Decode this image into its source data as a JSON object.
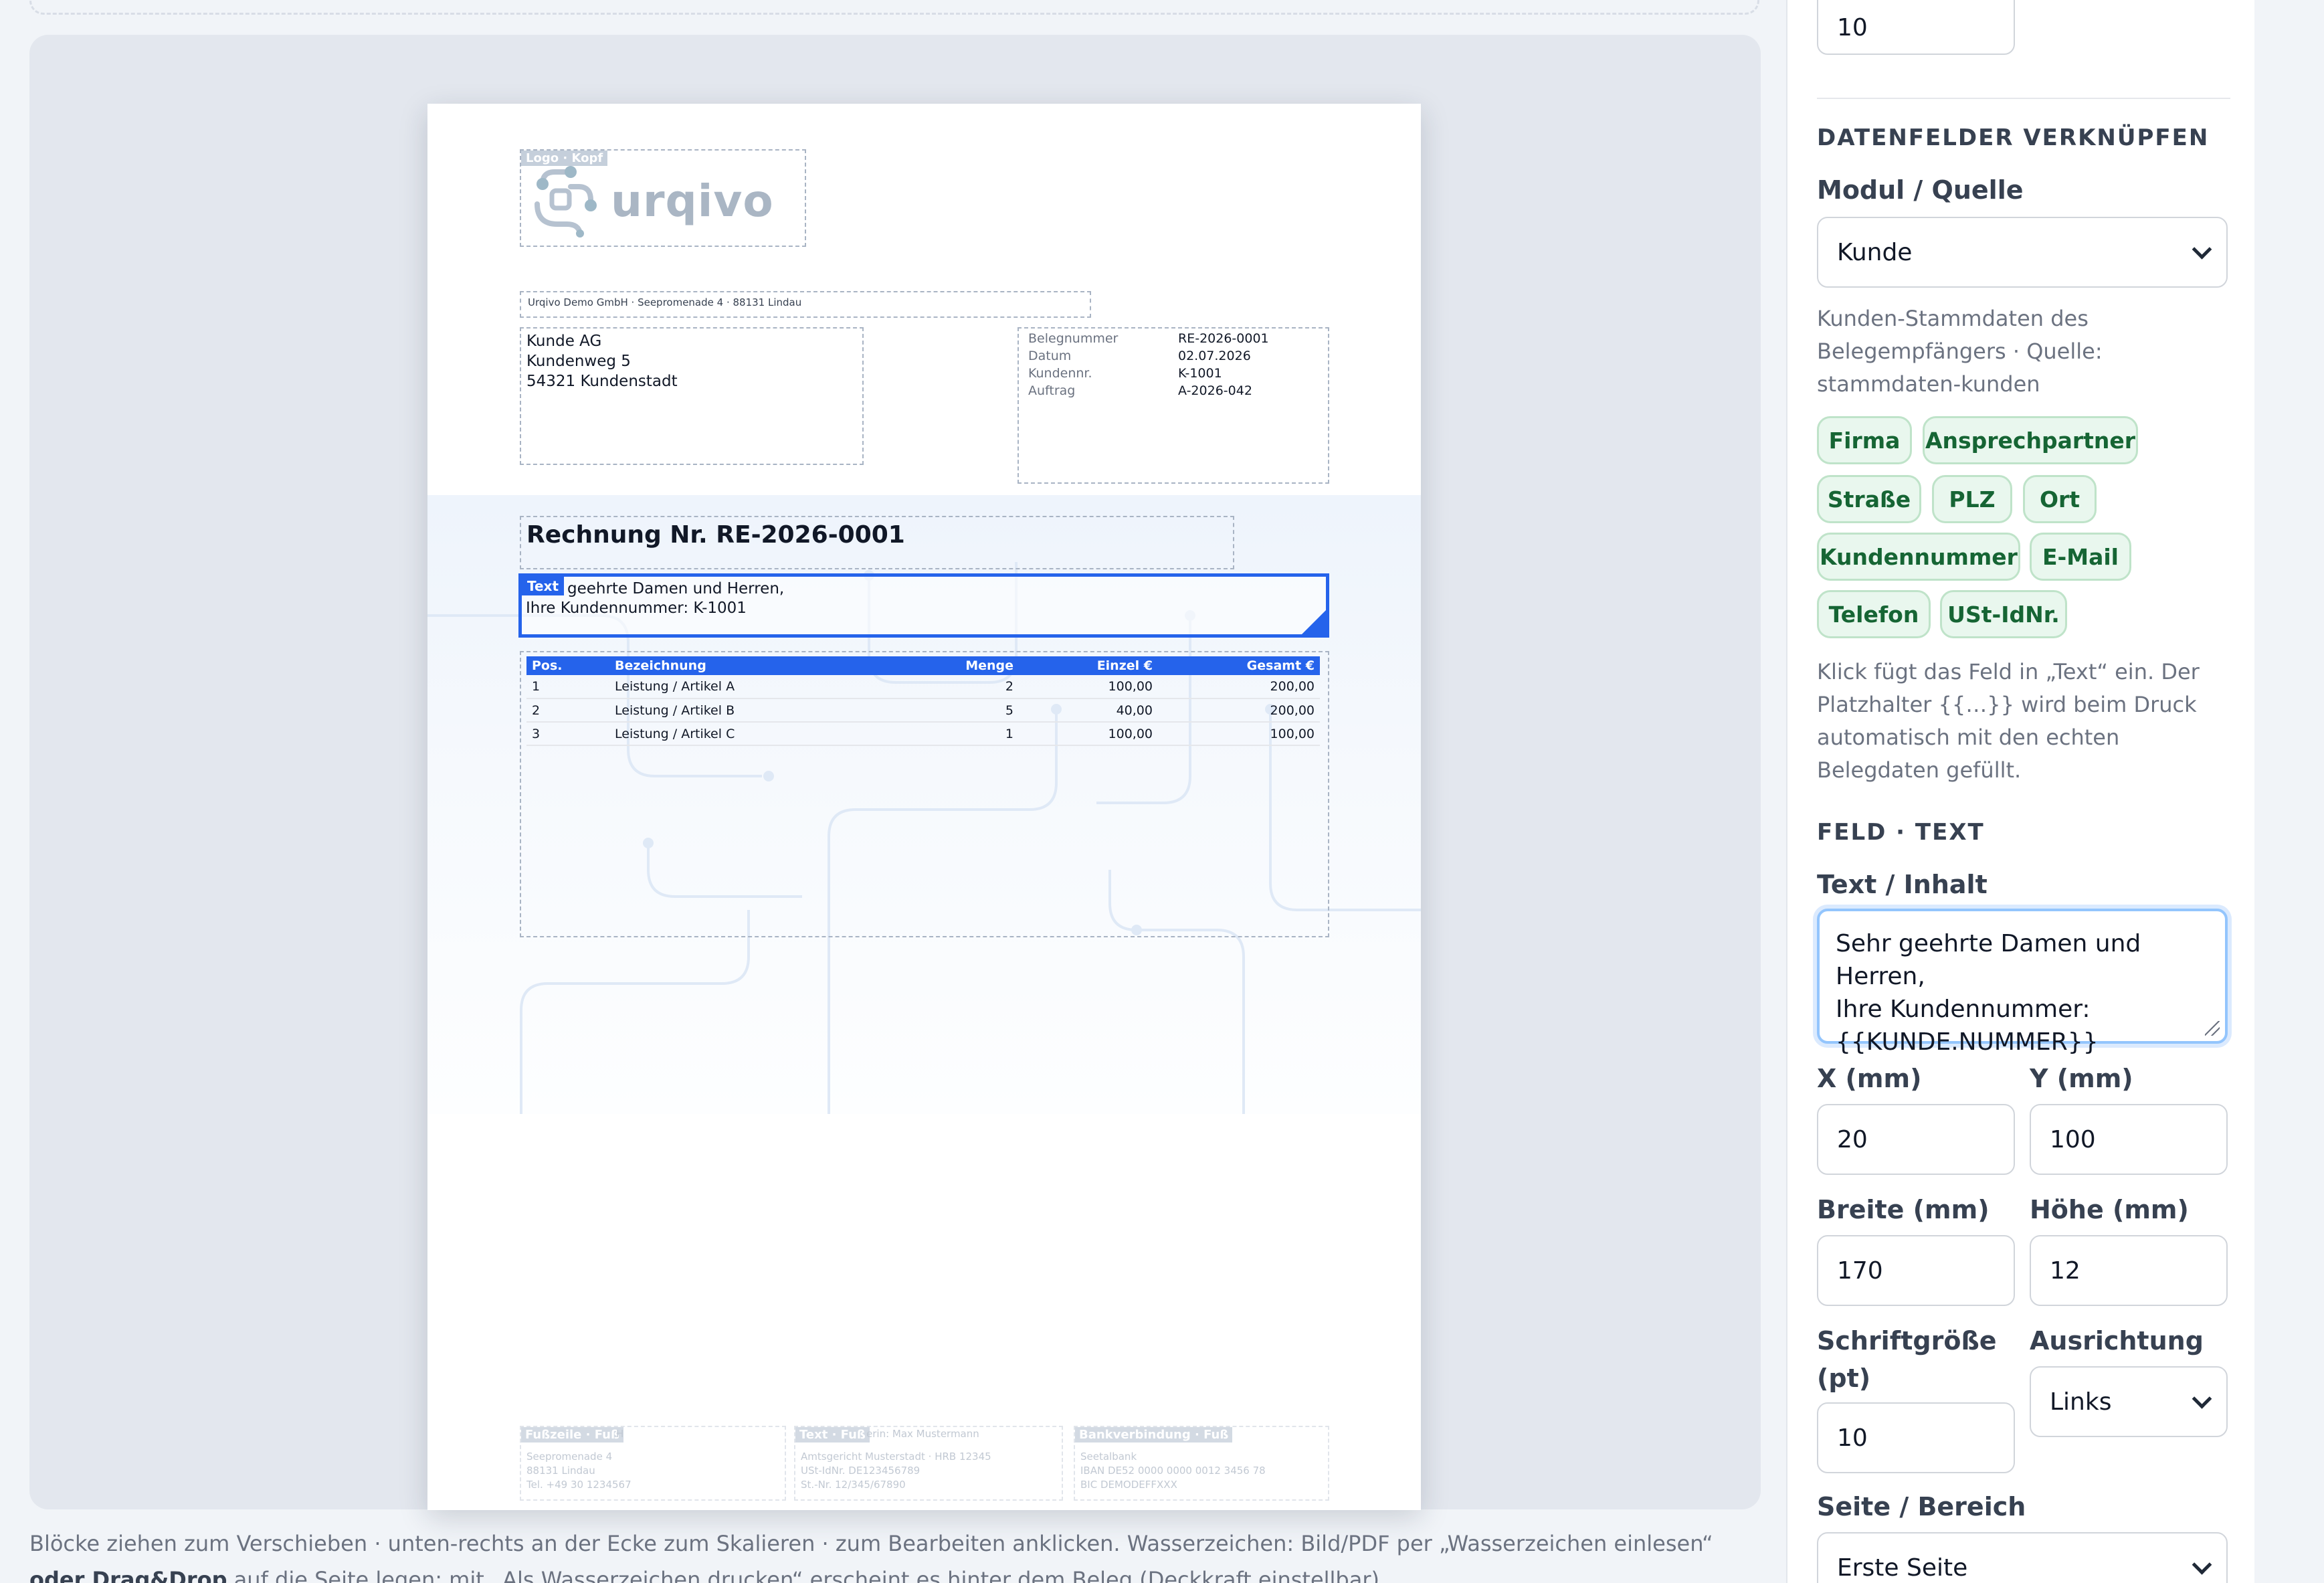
{
  "canvas": {
    "logo_block": {
      "tag": "Logo · Kopf",
      "word": "urqivo"
    },
    "sender_line": "Urqivo Demo GmbH · Seepromenade 4 · 88131 Lindau",
    "recipient": {
      "lines": [
        "Kunde AG",
        "Kundenweg 5",
        "54321 Kundenstadt"
      ]
    },
    "doc_meta": [
      {
        "label": "Belegnummer",
        "value": "RE-2026-0001"
      },
      {
        "label": "Datum",
        "value": "02.07.2026"
      },
      {
        "label": "Kundennr.",
        "value": "K-1001"
      },
      {
        "label": "Auftrag",
        "value": "A-2026-042"
      }
    ],
    "title": "Rechnung Nr. RE-2026-0001",
    "selected_block": {
      "tag": "Text",
      "line1": "geehrte Damen und Herren,",
      "line2": "Ihre Kundennummer: K-1001"
    },
    "items_table": {
      "headers": [
        "Pos.",
        "Bezeichnung",
        "Menge",
        "Einzel €",
        "Gesamt €"
      ],
      "rows": [
        [
          "1",
          "Leistung / Artikel A",
          "2",
          "100,00",
          "200,00"
        ],
        [
          "2",
          "Leistung / Artikel B",
          "5",
          "40,00",
          "200,00"
        ],
        [
          "3",
          "Leistung / Artikel C",
          "1",
          "100,00",
          "100,00"
        ]
      ]
    },
    "footer": [
      {
        "tag": "Fußzeile · Fuß",
        "tail": "H",
        "lines": [
          "Seepromenade 4",
          "88131 Lindau",
          "Tel. +49 30 1234567"
        ]
      },
      {
        "tag": "Text · Fuß",
        "tail": "erin: Max Mustermann",
        "lines": [
          "Amtsgericht Musterstadt · HRB 12345",
          "USt-IdNr. DE123456789",
          "St.-Nr. 12/345/67890"
        ]
      },
      {
        "tag": "Bankverbindung · Fuß",
        "tail": "",
        "lines": [
          "Seetalbank",
          "IBAN DE52 0000 0000 0012 3456 78",
          "BIC DEMODEFFXXX"
        ]
      }
    ]
  },
  "hint": {
    "part1": "Blöcke ziehen zum Verschieben · unten-rechts an der Ecke zum Skalieren · zum Bearbeiten anklicken. Wasserzeichen: Bild/PDF per „Wasserzeichen einlesen“",
    "bold": "oder Drag&Drop",
    "part2": "auf die Seite legen; mit „Als Wasserzeichen drucken“ erscheint es hinter dem Beleg (Deckkraft einstellbar)."
  },
  "panel": {
    "top_input_value": "10",
    "datafields_section": "DATENFELDER VERKNÜPFEN",
    "module_label": "Modul / Quelle",
    "module_value": "Kunde",
    "module_desc": "Kunden-Stammdaten des Belegempfängers · Quelle: stammdaten-kunden",
    "chips": [
      "Firma",
      "Ansprechpartner",
      "Straße",
      "PLZ",
      "Ort",
      "Kundennummer",
      "E-Mail",
      "Telefon",
      "USt-IdNr."
    ],
    "chips_desc": "Klick fügt das Feld in „Text“ ein. Der Platzhalter {{…}} wird beim Druck automatisch mit den echten Belegdaten gefüllt.",
    "field_section": "FELD · TEXT",
    "text_label": "Text / Inhalt",
    "text_value": "Sehr geehrte Damen und Herren,\nIhre Kundennummer:\n{{KUNDE.NUMMER}}",
    "x_label": "X (mm)",
    "x_value": "20",
    "y_label": "Y (mm)",
    "y_value": "100",
    "w_label": "Breite (mm)",
    "w_value": "170",
    "h_label": "Höhe (mm)",
    "h_value": "12",
    "fs_label": "Schriftgröße (pt)",
    "fs_value": "10",
    "align_label": "Ausrichtung",
    "align_value": "Links",
    "page_label": "Seite / Bereich",
    "page_value": "Erste Seite"
  }
}
